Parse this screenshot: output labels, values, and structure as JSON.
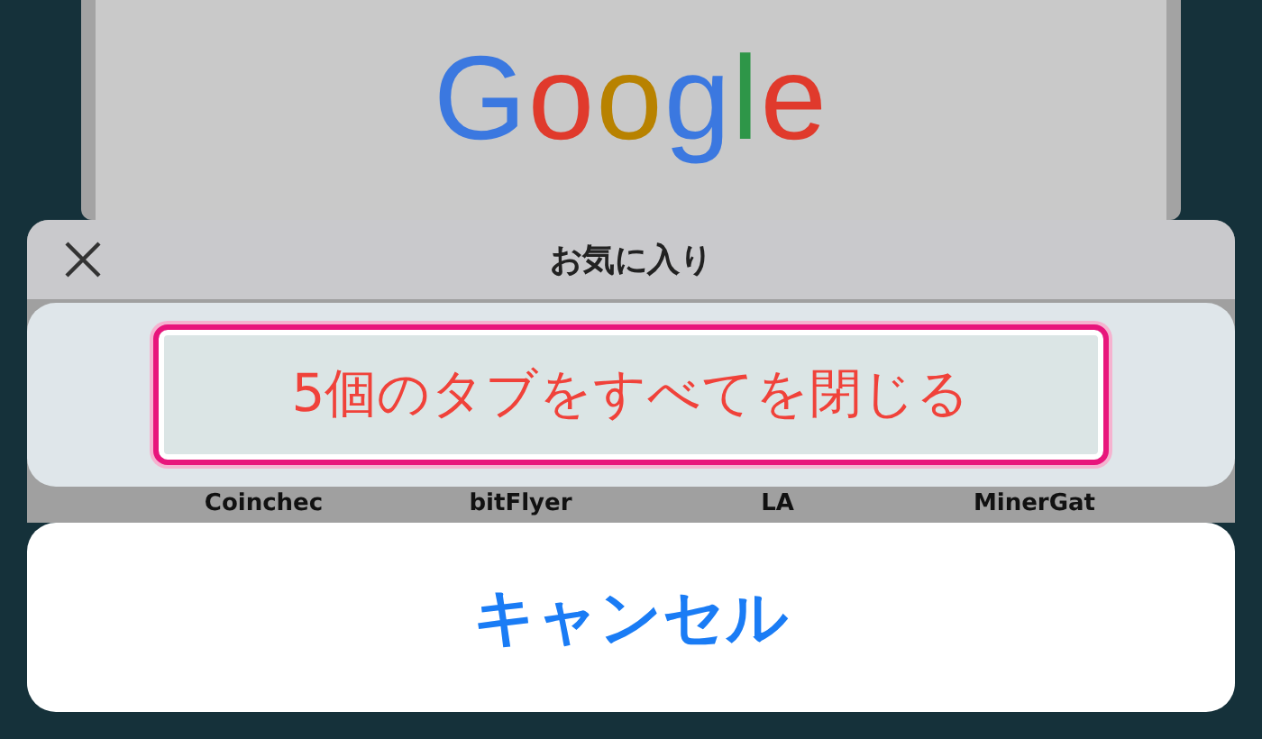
{
  "background_page": {
    "logo": "Google"
  },
  "favorites_panel": {
    "title": "お気に入り",
    "items": [
      "Coinchec",
      "bitFlyer",
      "LA",
      "MinerGat"
    ]
  },
  "action_sheet": {
    "close_all_button": {
      "label": "5個のタブをすべてを閉じる",
      "highlighted": true
    },
    "cancel_button": {
      "label": "キャンセル"
    }
  }
}
